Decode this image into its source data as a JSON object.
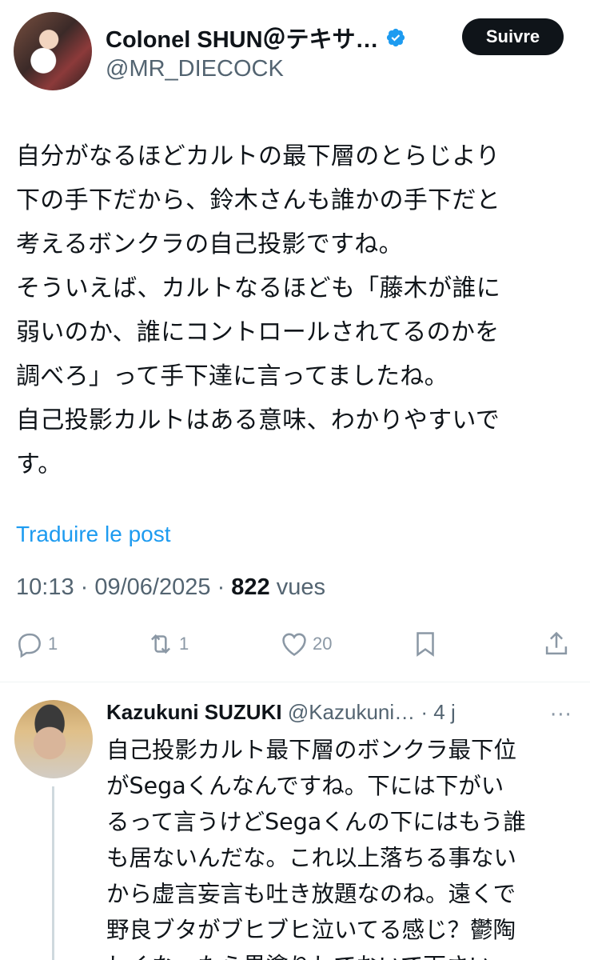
{
  "post": {
    "author": {
      "display_name": "Colonel SHUN＠テキサ…",
      "handle": "@MR_DIECOCK",
      "verified_icon": "verified-badge-icon",
      "verified_color": "#1d9bf0"
    },
    "follow_label": "Suivre",
    "text_lines": [
      "自分がなるほどカルトの最下層のとらじより",
      "下の手下だから、鈴木さんも誰かの手下だと",
      "考えるボンクラの自己投影ですね。",
      "そういえば、カルトなるほども「藤木が誰に",
      "弱いのか、誰にコントロールされてるのかを",
      "調べろ」って手下達に言ってましたね。",
      "自己投影カルトはある意味、わかりやすいで",
      "す。"
    ],
    "translate_label": "Traduire le post",
    "time": "10:13",
    "date": "09/06/2025",
    "views_count": "822",
    "views_label": "vues",
    "actions": {
      "reply_count": "1",
      "repost_count": "1",
      "like_count": "20"
    }
  },
  "reply": {
    "display_name": "Kazukuni SUZUKI",
    "handle": "@Kazukuni…",
    "age": "· 4 j",
    "more_icon": "more-dots-icon",
    "text_lines": [
      "自己投影カルト最下層のボンクラ最下位",
      "がSegaくんなんですね。下には下がい",
      "るって言うけどSegaくんの下にはもう誰",
      "も居ないんだな。これ以上落ちる事ない",
      "から虚言妄言も吐き放題なのね。遠くで",
      "野良ブタがブヒブヒ泣いてる感じ？鬱陶",
      "しくなったら黒塗りしておいて下さい。"
    ]
  },
  "colors": {
    "accent": "#1d9bf0",
    "text_primary": "#0f1419",
    "text_secondary": "#536471",
    "icon_gray": "#8b98a5"
  }
}
